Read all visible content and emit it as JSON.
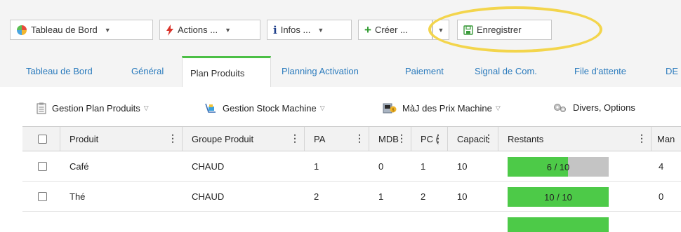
{
  "toolbar": {
    "dashboard_label": "Tableau de Bord",
    "actions_label": "Actions ...",
    "infos_label": "Infos ...",
    "create_label": "Créer ...",
    "save_label": "Enregistrer"
  },
  "tabs": [
    {
      "label": "Tableau de Bord"
    },
    {
      "label": "Général"
    },
    {
      "label": "Plan Produits"
    },
    {
      "label": "Planning Activation"
    },
    {
      "label": "Paiement"
    },
    {
      "label": "Signal de Com."
    },
    {
      "label": "File d'attente"
    },
    {
      "label": "DE"
    }
  ],
  "active_tab": "Plan Produits",
  "subtoolbar": {
    "plan_label": "Gestion Plan Produits",
    "stock_label": "Gestion Stock Machine",
    "price_label": "MàJ des Prix Machine",
    "misc_label": "Divers, Options"
  },
  "table": {
    "columns": [
      "Produit",
      "Groupe Produit",
      "PA",
      "MDB",
      "PC (",
      "Capacit",
      "Restants",
      "Man"
    ],
    "rows": [
      {
        "produit": "Café",
        "groupe": "CHAUD",
        "pa": "1",
        "mdb": "0",
        "pc": "1",
        "capacite": "10",
        "restants_label": "6 / 10",
        "restants_fraction": 0.6,
        "man": "4"
      },
      {
        "produit": "Thé",
        "groupe": "CHAUD",
        "pa": "2",
        "mdb": "1",
        "pc": "2",
        "capacite": "10",
        "restants_label": "10 / 10",
        "restants_fraction": 1.0,
        "man": "0"
      }
    ],
    "partial_row_restants_fraction": 1.0
  },
  "colors": {
    "accent_green": "#4bbf45",
    "bar_green": "#4dca48",
    "bar_grey": "#c4c4c4",
    "link_blue": "#2b7bbd",
    "highlight_yellow": "#f3d54c"
  }
}
